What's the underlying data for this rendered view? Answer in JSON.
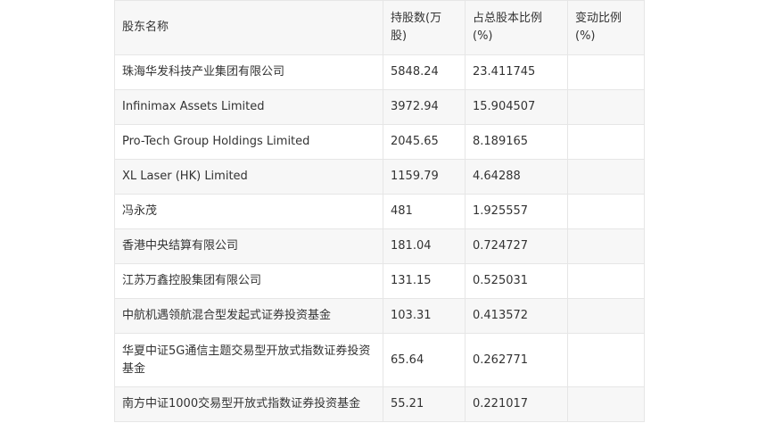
{
  "table": {
    "headers": [
      "股东名称",
      "持股数(万股)",
      "占总股本比例(%)",
      "变动比例(%)"
    ],
    "rows": [
      {
        "name": "珠海华发科技产业集团有限公司",
        "shares": "5848.24",
        "ratio": "23.411745",
        "change": ""
      },
      {
        "name": "Infinimax Assets Limited",
        "shares": "3972.94",
        "ratio": "15.904507",
        "change": ""
      },
      {
        "name": "Pro-Tech Group Holdings Limited",
        "shares": "2045.65",
        "ratio": "8.189165",
        "change": ""
      },
      {
        "name": "XL Laser (HK) Limited",
        "shares": "1159.79",
        "ratio": "4.64288",
        "change": ""
      },
      {
        "name": "冯永茂",
        "shares": "481",
        "ratio": "1.925557",
        "change": ""
      },
      {
        "name": "香港中央结算有限公司",
        "shares": "181.04",
        "ratio": "0.724727",
        "change": ""
      },
      {
        "name": "江苏万鑫控股集团有限公司",
        "shares": "131.15",
        "ratio": "0.525031",
        "change": ""
      },
      {
        "name": "中航机遇领航混合型发起式证券投资基金",
        "shares": "103.31",
        "ratio": "0.413572",
        "change": ""
      },
      {
        "name": "华夏中证5G通信主题交易型开放式指数证券投资基金",
        "shares": "65.64",
        "ratio": "0.262771",
        "change": ""
      },
      {
        "name": "南方中证1000交易型开放式指数证券投资基金",
        "shares": "55.21",
        "ratio": "0.221017",
        "change": ""
      }
    ]
  }
}
